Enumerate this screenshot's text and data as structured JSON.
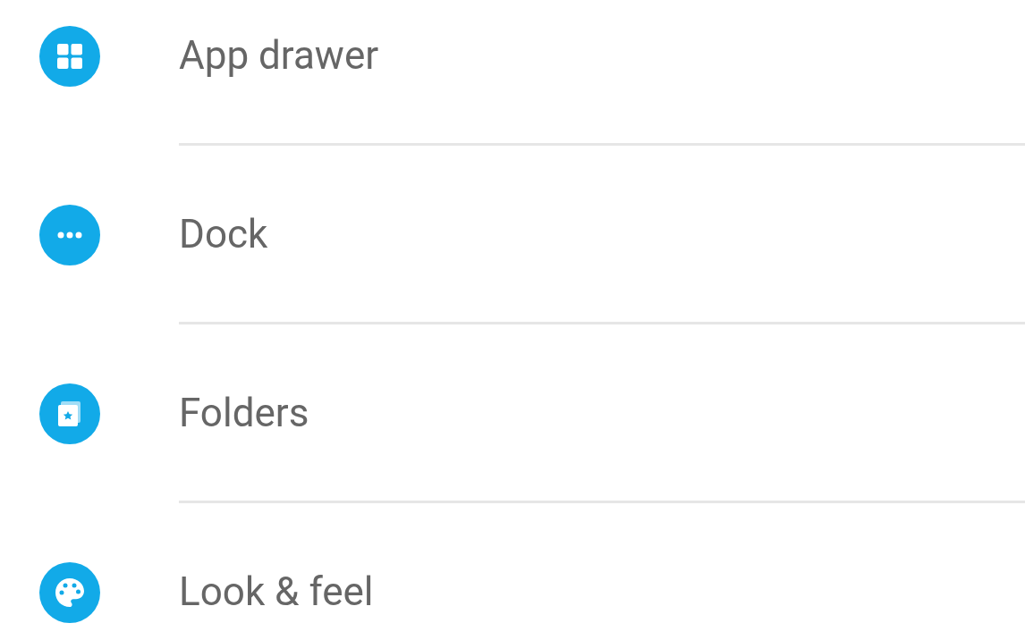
{
  "settings_items": [
    {
      "kind": "grid",
      "label": "App drawer"
    },
    {
      "kind": "dots",
      "label": "Dock"
    },
    {
      "kind": "folder",
      "label": "Folders"
    },
    {
      "kind": "palette",
      "label": "Look & feel"
    }
  ]
}
